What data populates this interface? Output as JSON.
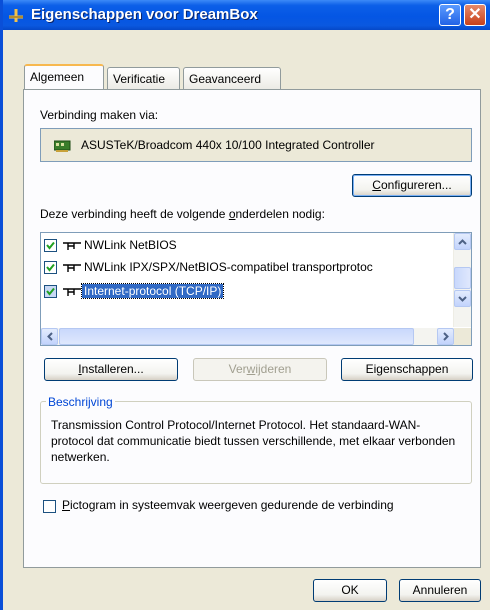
{
  "window": {
    "title": "Eigenschappen voor DreamBox",
    "help_glyph": "?",
    "close_glyph": "✕"
  },
  "tabs": [
    {
      "label": "Algemeen",
      "active": true
    },
    {
      "label": "Verificatie",
      "active": false
    },
    {
      "label": "Geavanceerd",
      "active": false
    }
  ],
  "connect_via": {
    "label": "Verbinding maken via:",
    "adapter": "ASUSTeK/Broadcom 440x 10/100 Integrated Controller",
    "configure_button_prefix": "C",
    "configure_button_rest": "onfigureren..."
  },
  "components": {
    "label_before": "Deze verbinding heeft de volgende ",
    "label_hotkey": "o",
    "label_after": "nderdelen nodig:",
    "items": [
      {
        "label": "NWLink NetBIOS",
        "checked": true,
        "selected": false
      },
      {
        "label": "NWLink IPX/SPX/NetBIOS-compatibel transportprotoc",
        "checked": true,
        "selected": false
      },
      {
        "label": "Internet-protocol (TCP/IP)",
        "checked": true,
        "selected": true
      }
    ]
  },
  "buttons": {
    "install_prefix": "I",
    "install_rest": "nstalleren...",
    "remove_before": "Ver",
    "remove_hotkey": "w",
    "remove_after": "ijderen",
    "properties_before": "Ei",
    "properties_hotkey": "g",
    "properties_after": "enschappen",
    "ok": "OK",
    "cancel": "Annuleren"
  },
  "description": {
    "title": "Beschrijving",
    "text": "Transmission Control Protocol/Internet Protocol. Het standaard-WAN-protocol dat communicatie biedt tussen verschillende, met elkaar verbonden netwerken."
  },
  "notify_checkbox": {
    "hotkey": "P",
    "rest": "ictogram in systeemvak weergeven gedurende de verbinding",
    "checked": false
  },
  "colors": {
    "titlebar": "#0456e4",
    "selection": "#316ac5",
    "group_title": "#0046d5",
    "dialog_bg": "#ece9d8"
  }
}
